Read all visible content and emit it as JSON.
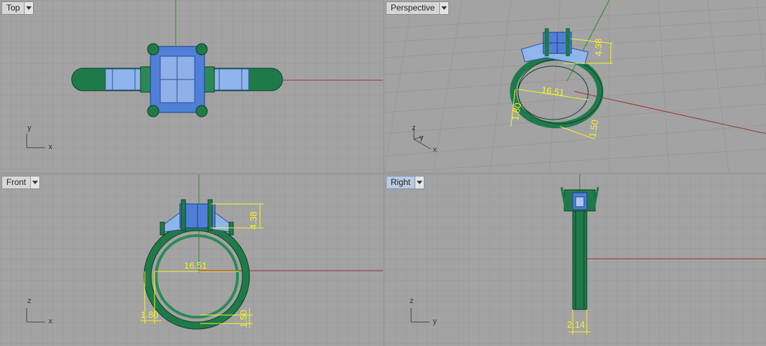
{
  "viewports": {
    "top": {
      "label": "Top",
      "axes": {
        "a": "y",
        "b": "x"
      }
    },
    "perspective": {
      "label": "Perspective",
      "axes": {
        "a": "z",
        "b": "y",
        "c": "x"
      },
      "dims": {
        "height": "4.38",
        "diameter": "16.51",
        "thickness": "1.80",
        "band": "1.50"
      }
    },
    "front": {
      "label": "Front",
      "axes": {
        "a": "z",
        "b": "x"
      },
      "dims": {
        "height": "4.38",
        "diameter": "16.51",
        "thickness": "1.80",
        "band": "1.50"
      }
    },
    "right": {
      "label": "Right",
      "active": true,
      "axes": {
        "a": "z",
        "b": "y"
      },
      "dims": {
        "width": "2.14"
      }
    }
  },
  "colors": {
    "grid_bg": "#a3a3a3",
    "grid_line": "#969696",
    "grid_major": "#8a8a8a",
    "x_axis": "#9c3030",
    "y_axis": "#2f8a2f",
    "metal": "#1f7a4a",
    "metal_edge": "#0e3d24",
    "gem": "#5f87d6",
    "gem_light": "#a8c8f0",
    "dimension": "#f5f52a"
  }
}
